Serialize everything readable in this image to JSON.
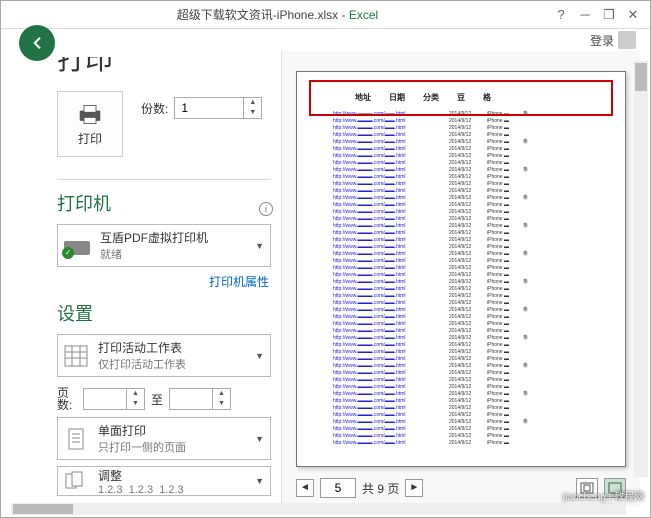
{
  "titlebar": {
    "filename": "超级下载软文资讯-iPhone.xlsx",
    "appname": "Excel",
    "login": "登录",
    "help": "?"
  },
  "page": {
    "heading": "打印"
  },
  "print_btn": {
    "label": "打印"
  },
  "copies": {
    "label": "份数:",
    "value": "1"
  },
  "printer": {
    "section": "打印机",
    "name": "互盾PDF虚拟打印机",
    "status": "就绪",
    "properties_link": "打印机属性"
  },
  "settings": {
    "section": "设置",
    "sheet": {
      "title": "打印活动工作表",
      "sub": "仅打印活动工作表"
    },
    "range": {
      "label_pages": "页\n数:",
      "from": "",
      "label_to": "至",
      "to": ""
    },
    "sided": {
      "title": "单面打印",
      "sub": "只打印一侧的页面"
    },
    "collate": {
      "title": "调整",
      "sub1": "1.2.3",
      "sub2": "1.2.3",
      "sub3": "1.2.3"
    }
  },
  "preview": {
    "headers": [
      "地址",
      "日期",
      "分类",
      "豆",
      "格"
    ],
    "row": {
      "url": "http://www.▬▬▬.com/▬▬.html",
      "date": "2014/9/12",
      "cat": "iPhone ▬",
      "c4": "条"
    }
  },
  "pager": {
    "current": "5",
    "total_label": "共 9 页"
  },
  "watermark": "jiaocheng | 教程网"
}
